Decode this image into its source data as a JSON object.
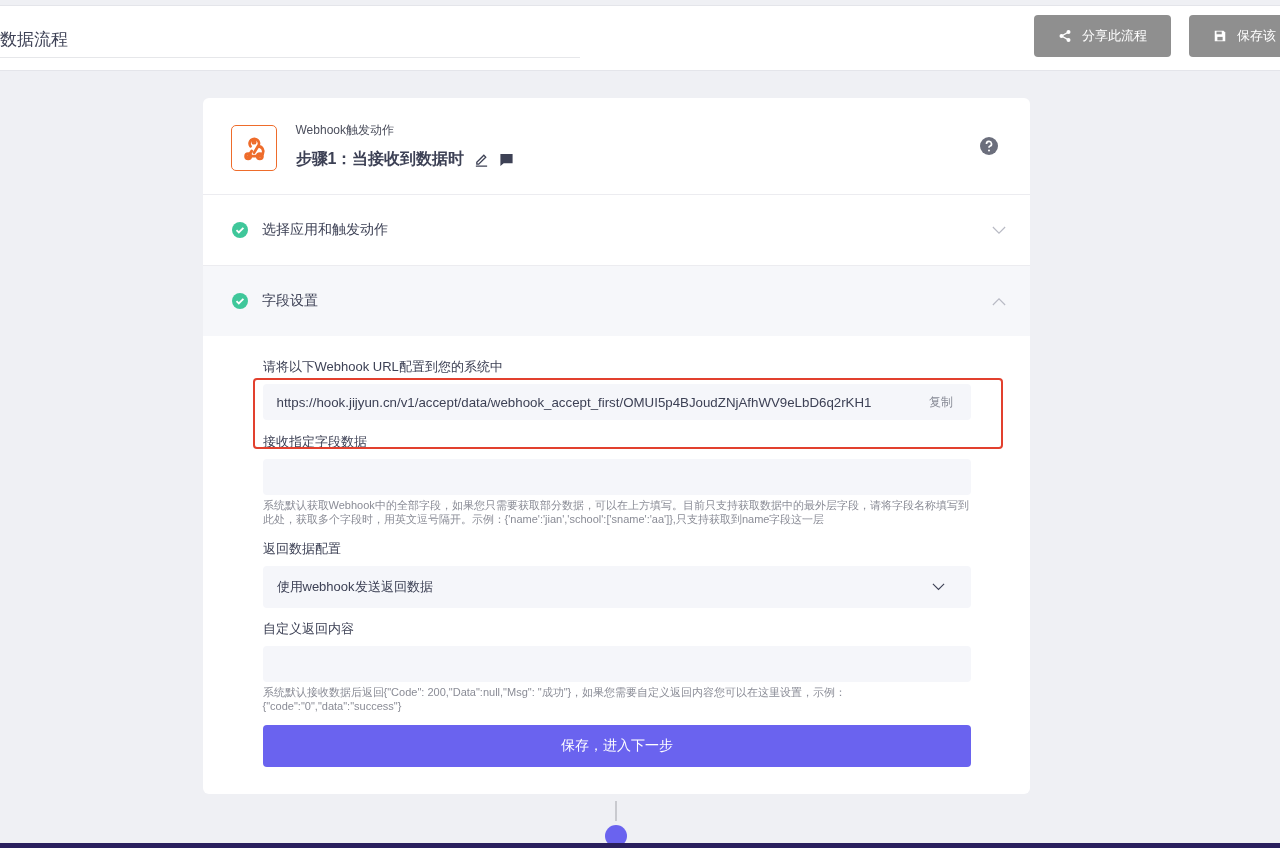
{
  "header": {
    "title": "数据流程",
    "buttons": [
      {
        "kind": "share",
        "label": "分享此流程",
        "disabled": true
      },
      {
        "kind": "save",
        "label": "保存该",
        "disabled": true
      }
    ]
  },
  "step": {
    "app_name": "Webhook触发动作",
    "title": "步骤1：当接收到数据时"
  },
  "sections": [
    {
      "label": "选择应用和触发动作",
      "done": true,
      "expanded": false
    },
    {
      "label": "字段设置",
      "done": true,
      "expanded": true
    }
  ],
  "form": {
    "url_label": "请将以下Webhook URL配置到您的系统中",
    "url_value": "https://hook.jijyun.cn/v1/accept/data/webhook_accept_first/OMUI5p4BJoudZNjAfhWV9eLbD6q2rKH1",
    "copy_label": "复制",
    "highlighted": true,
    "field_label": "接收指定字段数据",
    "field_hint": "系统默认获取Webhook中的全部字段，如果您只需要获取部分数据，可以在上方填写。目前只支持获取数据中的最外层字段，请将字段名称填写到此处，获取多个字段时，用英文逗号隔开。示例：{'name':'jian','school':['sname':'aa']},只支持获取到name字段这一层",
    "return_label": "返回数据配置",
    "return_value": "使用webhook发送返回数据",
    "custom_label": "自定义返回内容",
    "custom_hint": "系统默认接收数据后返回{\"Code\": 200,\"Data\":null,\"Msg\": \"成功\"}，如果您需要自定义返回内容您可以在这里设置，示例：{\"code\":\"0\",\"data\":\"success\"}",
    "submit": "保存，进入下一步"
  }
}
